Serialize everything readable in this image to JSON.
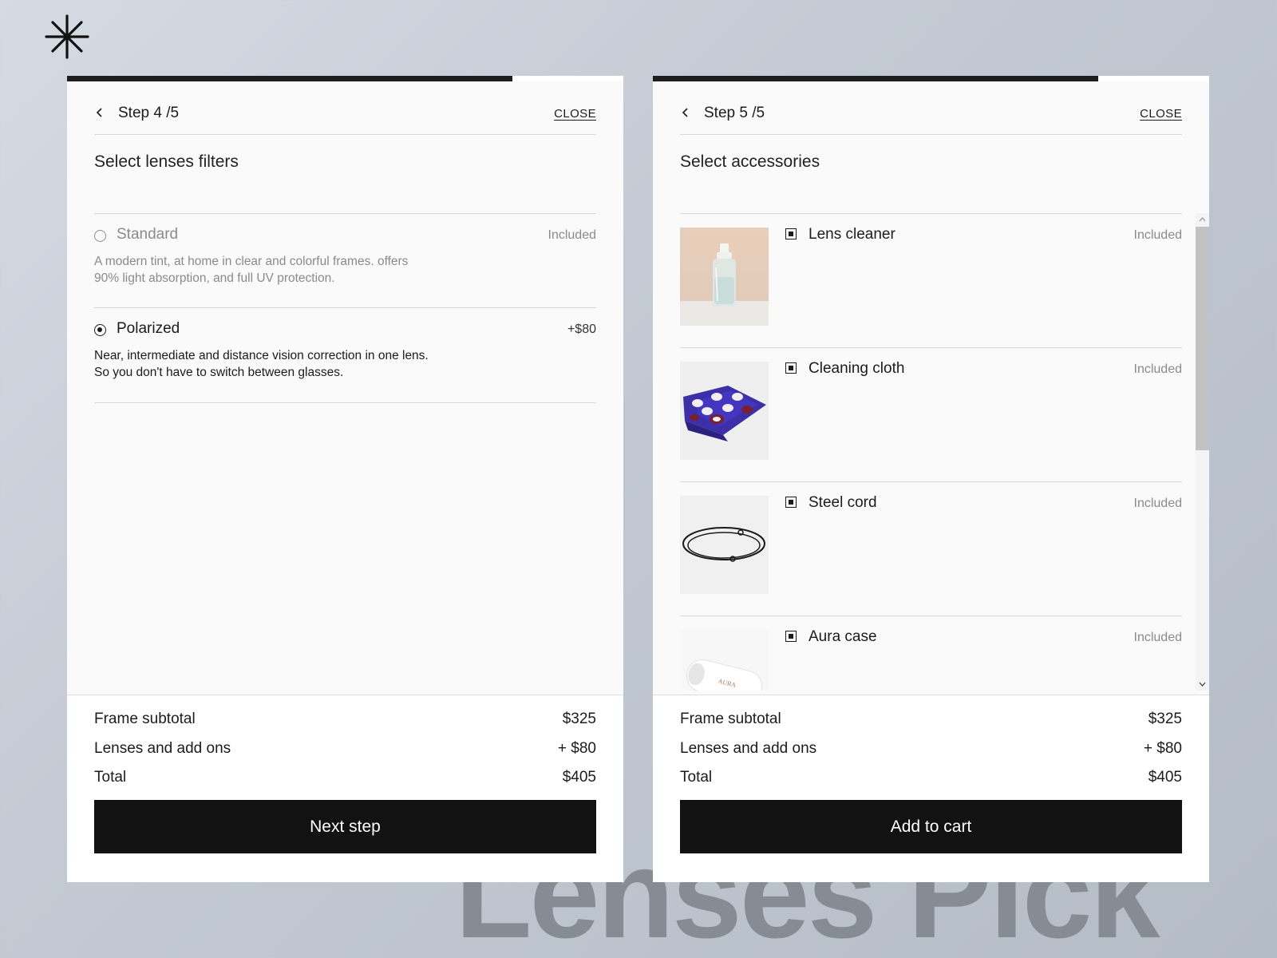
{
  "brand": {
    "logo_icon": "asterisk-icon"
  },
  "background_title": "Lenses Pick",
  "panels": [
    {
      "progress": 0.8,
      "step": "Step 4 /5",
      "close_label": "CLOSE",
      "title": "Select lenses filters",
      "options": [
        {
          "name": "Standard",
          "price": "Included",
          "description_line1": "A modern tint, at home in clear and colorful frames. offers",
          "description_line2": "90% light absorption, and full UV protection.",
          "selected": false
        },
        {
          "name": "Polarized",
          "price": "+$80",
          "description_line1": "Near, intermediate and distance vision correction in one lens.",
          "description_line2": "So you don't have to switch between glasses.",
          "selected": true
        }
      ],
      "summary": {
        "frame_label": "Frame subtotal",
        "frame_value": "$325",
        "lenses_label": "Lenses and add ons",
        "lenses_value": "+ $80",
        "total_label": "Total",
        "total_value": "$405"
      },
      "cta": "Next step"
    },
    {
      "progress": 0.8,
      "step": "Step 5 /5",
      "close_label": "CLOSE",
      "title": "Select accessories",
      "accessories": [
        {
          "name": "Lens cleaner",
          "price": "Included",
          "checked": true,
          "image": "spray-bottle-image"
        },
        {
          "name": "Cleaning cloth",
          "price": "Included",
          "checked": true,
          "image": "cloth-image"
        },
        {
          "name": "Steel cord",
          "price": "Included",
          "checked": true,
          "image": "cord-image"
        },
        {
          "name": "Aura case",
          "price": "Included",
          "checked": true,
          "image": "case-image",
          "image_text": "AURA"
        }
      ],
      "summary": {
        "frame_label": "Frame subtotal",
        "frame_value": "$325",
        "lenses_label": "Lenses and add ons",
        "lenses_value": "+ $80",
        "total_label": "Total",
        "total_value": "$405"
      },
      "cta": "Add to cart"
    }
  ],
  "colors": {
    "accent": "#121212",
    "panel_bg": "#fafafa",
    "muted_text": "#8a8a8a",
    "background_title": "#858c94"
  }
}
